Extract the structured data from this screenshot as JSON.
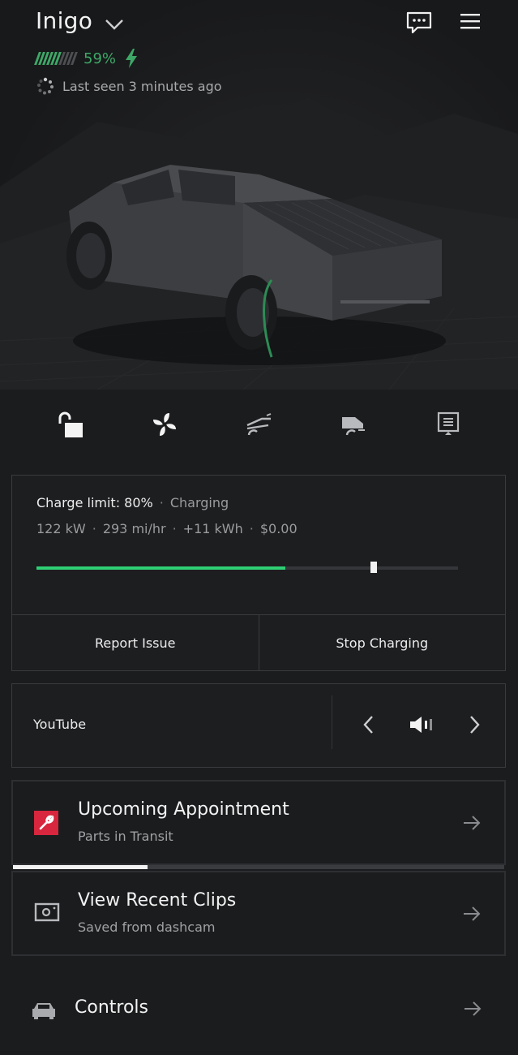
{
  "vehicle": {
    "name": "Inigo",
    "battery_percent_text": "59%",
    "battery_level": 0.59,
    "last_seen": "Last seen 3 minutes ago"
  },
  "icons": {
    "dropdown": "chevron-down-icon",
    "messages": "message-icon",
    "menu": "menu-icon",
    "charging": "bolt-icon",
    "last_seen": "spinner-icon",
    "quick_controls": [
      "unlock-icon",
      "fan-icon",
      "frunk-icon",
      "tonneau-icon",
      "charge-port-icon"
    ]
  },
  "charging": {
    "limit_label": "Charge limit: 80%",
    "status": "Charging",
    "stats": [
      "122 kW",
      "293 mi/hr",
      "+11 kWh",
      "$0.00"
    ],
    "current_level": 0.59,
    "limit_level": 0.8,
    "buttons": {
      "report": "Report Issue",
      "stop": "Stop Charging"
    }
  },
  "media": {
    "source": "YouTube"
  },
  "cards": {
    "appointment": {
      "title": "Upcoming Appointment",
      "subtitle": "Parts in Transit"
    },
    "clips": {
      "title": "View Recent Clips",
      "subtitle": "Saved from dashcam"
    }
  },
  "controls": {
    "label": "Controls"
  },
  "colors": {
    "accent_green": "#2fcf74",
    "battery_green": "#3ea867",
    "service_red": "#d7263d",
    "background": "#1b1c1e"
  }
}
